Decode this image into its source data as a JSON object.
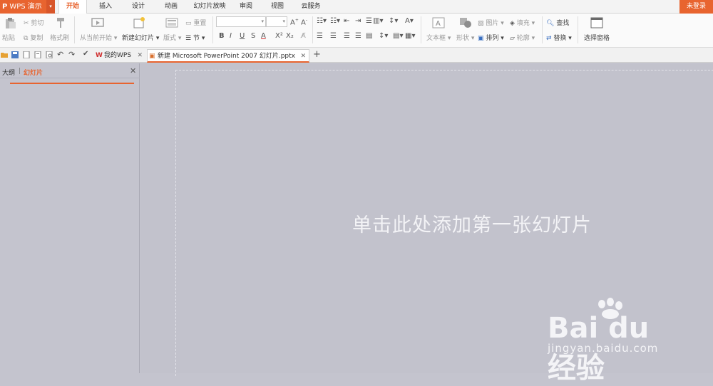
{
  "app": {
    "name": "WPS 演示",
    "login_label": "未登录"
  },
  "menu": {
    "tabs": [
      "开始",
      "插入",
      "设计",
      "动画",
      "幻灯片放映",
      "审阅",
      "视图",
      "云服务"
    ],
    "active": "开始"
  },
  "ribbon": {
    "paste": "粘贴",
    "cut": "剪切",
    "copy": "复制",
    "format_painter": "格式刷",
    "play_from_current": "从当前开始",
    "new_slide": "新建幻灯片",
    "layout": "版式",
    "reset": "重置",
    "section": "节",
    "bold": "B",
    "italic": "I",
    "underline": "U",
    "shadow": "S",
    "font_color": "A",
    "superscript": "X²",
    "subscript": "X₂",
    "textbox": "文本框",
    "shape": "形状",
    "picture": "图片",
    "fill": "填充",
    "arrange": "排列",
    "outline": "轮廓",
    "find": "查找",
    "replace": "替换",
    "selection_pane": "选择窗格"
  },
  "doc_tabs": [
    {
      "label": "我的WPS",
      "active": false
    },
    {
      "label": "新建 Microsoft PowerPoint 2007 幻灯片.pptx",
      "active": true
    }
  ],
  "left_panel": {
    "outline_tab": "大纲",
    "divider": "|",
    "slides_tab": "幻灯片"
  },
  "slide": {
    "placeholder": "单击此处添加第一张幻灯片"
  },
  "watermark": {
    "brand": "Bai du 经验",
    "url": "jingyan.baidu.com"
  },
  "colors": {
    "accent": "#e8642f",
    "workspace": "#c4c4ce"
  }
}
